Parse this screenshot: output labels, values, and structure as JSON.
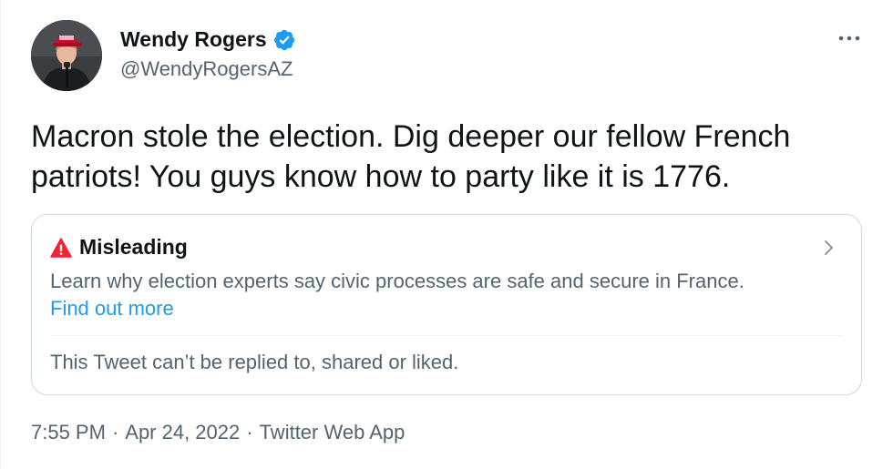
{
  "author": {
    "name": "Wendy Rogers",
    "handle": "@WendyRogersAZ",
    "verified": true
  },
  "tweet": {
    "text_line1": "Macron stole the election. Dig deeper our fellow French",
    "text_line2": "patriots! You guys know how to party like it is 1776."
  },
  "notice": {
    "icon": "warning-icon",
    "title": "Misleading",
    "body": "Learn why election experts say civic processes are safe and secure in France.",
    "link": "Find out more",
    "restriction": "This Tweet can’t be replied to, shared or liked."
  },
  "meta": {
    "time": "7:55 PM",
    "date": "Apr 24, 2022",
    "source": "Twitter Web App",
    "separator": "·"
  },
  "colors": {
    "text": "#0f1419",
    "secondary": "#536471",
    "link": "#1d9bf0",
    "verified": "#1d9bf0",
    "warning": "#f4212e",
    "border": "#cfd9de"
  },
  "icons": {
    "verified": "verified-badge-icon",
    "more": "more-options-icon",
    "chevron": "chevron-right-icon"
  }
}
